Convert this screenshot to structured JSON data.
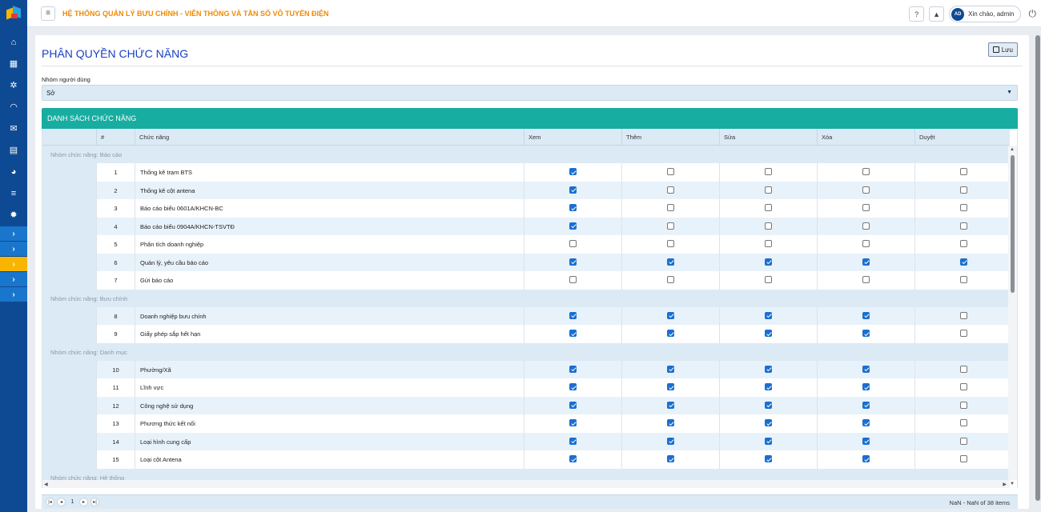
{
  "app": {
    "title": "HỆ THỐNG QUẢN LÝ BƯU CHÍNH - VIỄN THÔNG VÀ TẦN SỐ VÔ TUYẾN ĐIỆN"
  },
  "topbar": {
    "help_icon": "question-circle-icon",
    "bell_icon": "bell-icon",
    "avatar_initials": "AD",
    "greeting": "Xin chào, admin",
    "power_icon": "power-icon"
  },
  "sidebar": {
    "icons": [
      "home-icon",
      "map-icon",
      "network-icon",
      "wifi-icon",
      "mail-icon",
      "id-card-icon",
      "pie-chart-icon",
      "list-icon",
      "gear-icon"
    ],
    "expanders": [
      "›",
      "›",
      "›",
      "›",
      "›"
    ]
  },
  "page": {
    "title": "PHÂN QUYỀN CHỨC NĂNG",
    "save_label": "Lưu"
  },
  "user_group": {
    "label": "Nhóm người dùng",
    "value": "Sở"
  },
  "grid": {
    "header": "DANH SÁCH CHỨC NĂNG",
    "columns": [
      "#",
      "Chức năng",
      "Xem",
      "Thêm",
      "Sửa",
      "Xóa",
      "Duyệt"
    ],
    "groups": [
      {
        "label": "Nhóm chức năng: Báo cáo",
        "rows": [
          {
            "num": "1",
            "name": "Thống kê trạm BTS",
            "perms": [
              true,
              false,
              false,
              false,
              false
            ]
          },
          {
            "num": "2",
            "name": "Thống kê cột antena",
            "perms": [
              true,
              false,
              false,
              false,
              false
            ]
          },
          {
            "num": "3",
            "name": "Báo cáo biểu 0601A/KHCN-BC",
            "perms": [
              true,
              false,
              false,
              false,
              false
            ]
          },
          {
            "num": "4",
            "name": "Báo cáo biểu 0904A/KHCN-TSVTĐ",
            "perms": [
              true,
              false,
              false,
              false,
              false
            ]
          },
          {
            "num": "5",
            "name": "Phân tích doanh nghiệp",
            "perms": [
              false,
              false,
              false,
              false,
              false
            ]
          },
          {
            "num": "6",
            "name": "Quản lý, yêu cầu báo cáo",
            "perms": [
              true,
              true,
              true,
              true,
              true
            ]
          },
          {
            "num": "7",
            "name": "Gửi báo cáo",
            "perms": [
              false,
              false,
              false,
              false,
              false
            ]
          }
        ]
      },
      {
        "label": "Nhóm chức năng: Bưu chính",
        "rows": [
          {
            "num": "8",
            "name": "Doanh nghiệp bưu chính",
            "perms": [
              true,
              true,
              true,
              true,
              false
            ]
          },
          {
            "num": "9",
            "name": "Giấy phép sắp hết hạn",
            "perms": [
              true,
              true,
              true,
              true,
              false
            ]
          }
        ]
      },
      {
        "label": "Nhóm chức năng: Danh mục",
        "rows": [
          {
            "num": "10",
            "name": "Phường/Xã",
            "perms": [
              true,
              true,
              true,
              true,
              false
            ]
          },
          {
            "num": "11",
            "name": "Lĩnh vực",
            "perms": [
              true,
              true,
              true,
              true,
              false
            ]
          },
          {
            "num": "12",
            "name": "Công nghệ sử dụng",
            "perms": [
              true,
              true,
              true,
              true,
              false
            ]
          },
          {
            "num": "13",
            "name": "Phương thức kết nối",
            "perms": [
              true,
              true,
              true,
              true,
              false
            ]
          },
          {
            "num": "14",
            "name": "Loại hình cung cấp",
            "perms": [
              true,
              true,
              true,
              true,
              false
            ]
          },
          {
            "num": "15",
            "name": "Loại cột Antena",
            "perms": [
              true,
              true,
              true,
              true,
              false
            ]
          }
        ]
      },
      {
        "label": "Nhóm chức năng: Hệ thống",
        "rows": []
      }
    ]
  },
  "pager": {
    "first": "|◂",
    "prev": "◂",
    "page": "1",
    "next": "▸",
    "last": "▸|",
    "info": "NaN - NaN of 38 items"
  }
}
